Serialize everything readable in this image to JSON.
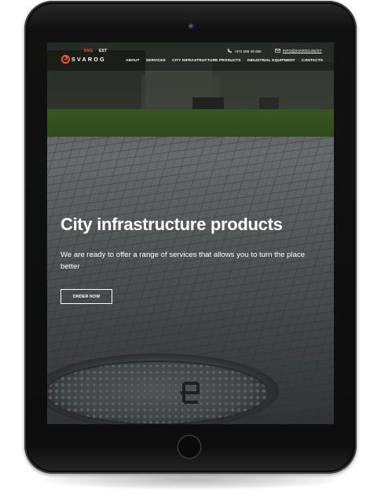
{
  "header": {
    "languages": [
      "ENG",
      "EST"
    ],
    "active_language": "ENG",
    "logo_text": "SVAROG",
    "phone": "+372 588 49 888",
    "email": "INFO@SVAROG.EE/ST",
    "nav": [
      "ABOUT",
      "SERVICES",
      "CITY INFRASTRUCTURE PRODUCTS",
      "INDUSTRIAL EQUIPMENT",
      "CONTACTS"
    ]
  },
  "hero": {
    "title": "City infrastructure products",
    "subtitle": "We are ready to offer a range of services that allows you to turn the place better",
    "cta_label": "ORDER NOW"
  },
  "icons": {
    "phone": "phone-icon",
    "email": "email-icon",
    "logo": "svarog-flame-logo-icon"
  },
  "colors": {
    "accent": "#e8581c",
    "text": "#ffffff",
    "device_frame": "#111111"
  }
}
